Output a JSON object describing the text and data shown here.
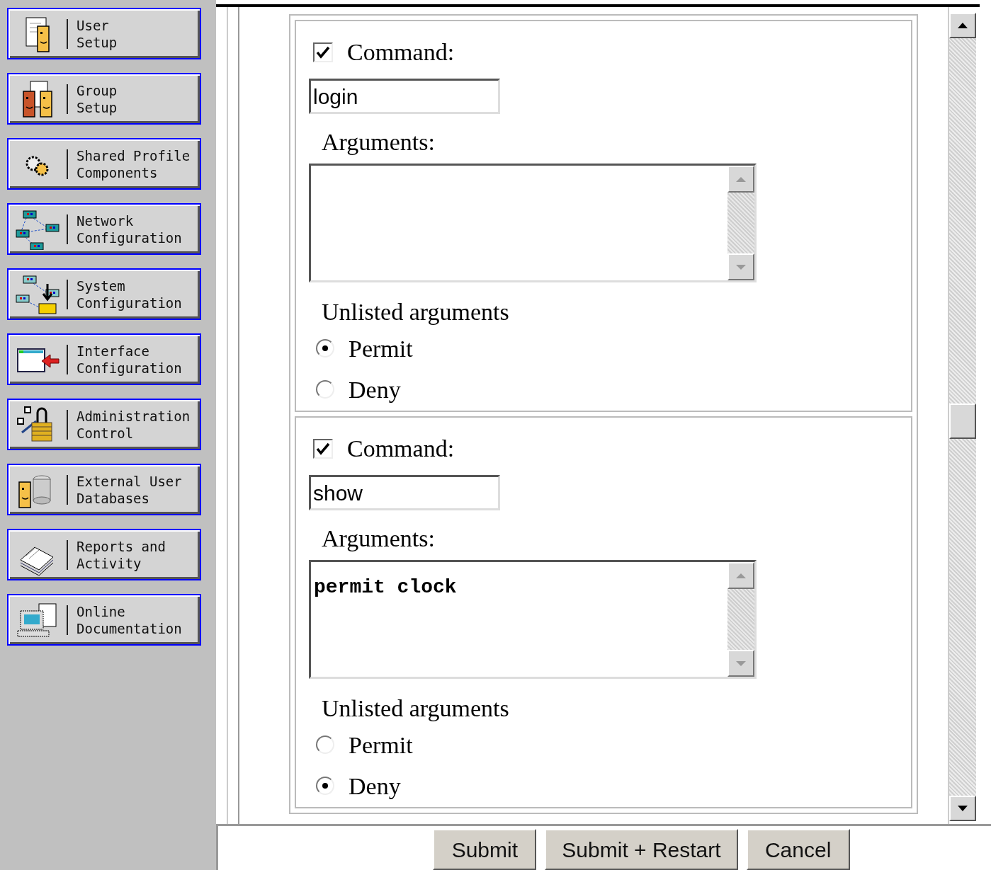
{
  "sidebar": {
    "items": [
      {
        "kind": "user",
        "lines": [
          "User",
          "Setup"
        ]
      },
      {
        "kind": "group",
        "lines": [
          "Group",
          "Setup"
        ]
      },
      {
        "kind": "gears",
        "lines": [
          "Shared Profile",
          "Components"
        ]
      },
      {
        "kind": "network",
        "lines": [
          "Network",
          "Configuration"
        ]
      },
      {
        "kind": "system",
        "lines": [
          "System",
          "Configuration"
        ]
      },
      {
        "kind": "interface",
        "lines": [
          "Interface",
          "Configuration"
        ]
      },
      {
        "kind": "admin",
        "lines": [
          "Administration",
          "Control"
        ]
      },
      {
        "kind": "database",
        "lines": [
          "External User",
          "Databases"
        ]
      },
      {
        "kind": "reports",
        "lines": [
          "Reports and",
          "Activity"
        ]
      },
      {
        "kind": "docs",
        "lines": [
          "Online",
          "Documentation"
        ]
      }
    ]
  },
  "sections": [
    {
      "checked": true,
      "command_label": "Command:",
      "command": "login",
      "arguments_label": "Arguments:",
      "unlisted_label": "Unlisted arguments",
      "options": [
        {
          "label": "Permit",
          "selected": true
        },
        {
          "label": "Deny",
          "selected": false
        }
      ]
    },
    {
      "checked": true,
      "command_label": "Command:",
      "command": "show",
      "arguments_label": "Arguments:",
      "arguments": "permit clock",
      "unlisted_label": "Unlisted arguments",
      "options": [
        {
          "label": "Permit",
          "selected": false
        },
        {
          "label": "Deny",
          "selected": true
        }
      ]
    }
  ],
  "buttons": [
    "Submit",
    "Submit + Restart",
    "Cancel"
  ]
}
